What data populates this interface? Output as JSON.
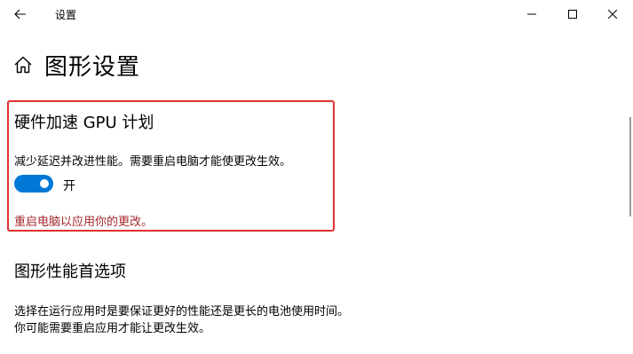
{
  "window": {
    "title": "设置"
  },
  "page": {
    "title": "图形设置"
  },
  "gpu_scheduling": {
    "heading": "硬件加速 GPU 计划",
    "description": "减少延迟并改进性能。需要重启电脑才能使更改生效。",
    "toggle_state_label": "开",
    "toggle_on": true,
    "restart_note": "重启电脑以应用你的更改。"
  },
  "graphics_preference": {
    "heading": "图形性能首选项",
    "description_line1": "选择在运行应用时是要保证更好的性能还是更长的电池使用时间。",
    "description_line2": "你可能需要重启应用才能让更改生效。"
  },
  "colors": {
    "accent": "#0078d7",
    "highlight_border": "#e0312f",
    "warning_text": "#a4262c"
  },
  "icons": {
    "back": "back-arrow-icon",
    "home": "home-icon",
    "minimize": "minimize-icon",
    "maximize": "maximize-icon",
    "close": "close-icon"
  }
}
